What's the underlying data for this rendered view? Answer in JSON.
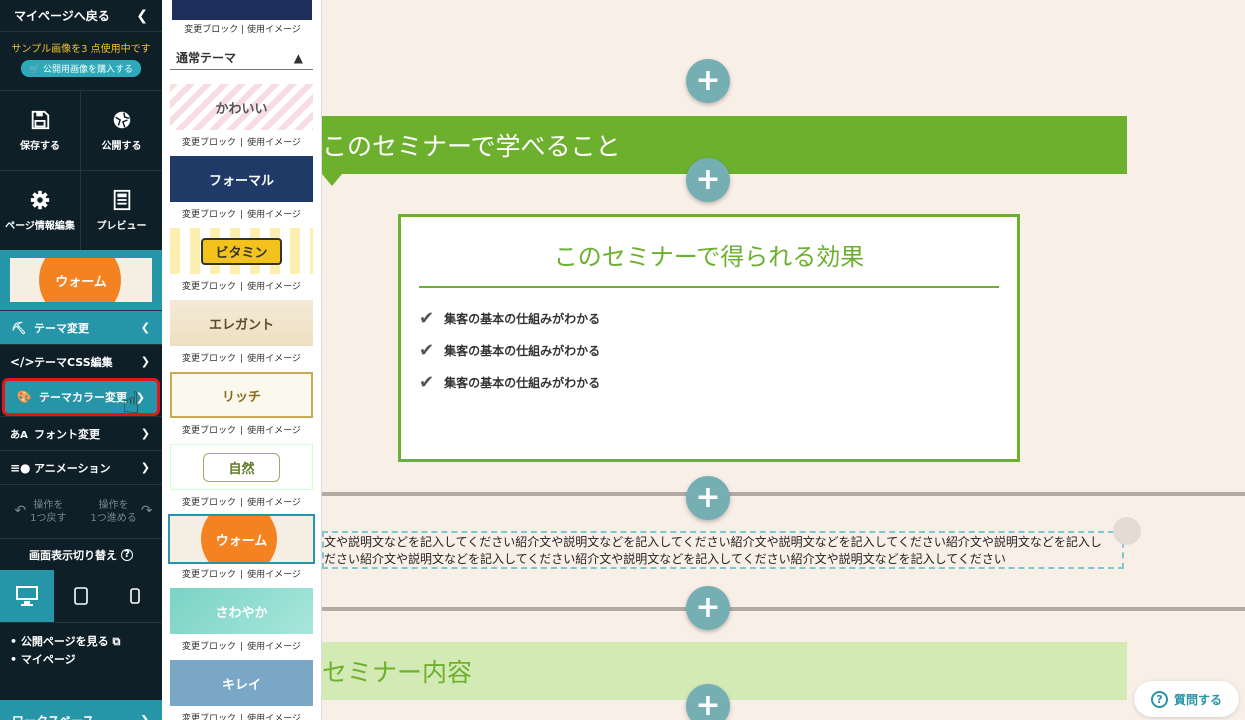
{
  "sidebar": {
    "back_label": "マイページへ戻る",
    "notice_text": "サンプル画像を3 点使用中です",
    "buy_button": "公開用画像を購入する",
    "actions": [
      {
        "label": "保存する",
        "icon": "save-icon"
      },
      {
        "label": "公開する",
        "icon": "publish-icon"
      },
      {
        "label": "ページ情報編集",
        "icon": "gear-icon"
      },
      {
        "label": "プレビュー",
        "icon": "preview-icon"
      }
    ],
    "current_theme_label": "ウォーム",
    "menu": [
      {
        "label": "テーマ変更",
        "icon": "paint-roller-icon",
        "state": "open"
      },
      {
        "label": "テーマCSS編集",
        "icon": "code-icon"
      },
      {
        "label": "テーマカラー変更",
        "icon": "palette-icon",
        "state": "highlighted"
      },
      {
        "label": "フォント変更",
        "icon": "font-icon"
      },
      {
        "label": "アニメーション",
        "icon": "animation-icon"
      }
    ],
    "undo_label_1": "操作を",
    "undo_label_2": "1つ戻す",
    "redo_label_1": "操作を",
    "redo_label_2": "1つ進める",
    "display_switch_label": "画面表示切り替え",
    "links": [
      "公開ページを見る",
      "マイページ"
    ],
    "workspace_label": "ワークスペース"
  },
  "themes_panel": {
    "top_caption": "変更ブロック | 使用イメージ",
    "section_title": "通常テーマ",
    "change_block": "変更ブロック",
    "use_image": "使用イメージ",
    "items": [
      {
        "name": "かわいい",
        "style": "kawaii"
      },
      {
        "name": "フォーマル",
        "style": "formal"
      },
      {
        "name": "ビタミン",
        "style": "vitamin"
      },
      {
        "name": "エレガント",
        "style": "elegant"
      },
      {
        "name": "リッチ",
        "style": "rich"
      },
      {
        "name": "自然",
        "style": "natural"
      },
      {
        "name": "ウォーム",
        "style": "warm",
        "selected": true
      },
      {
        "name": "さわやか",
        "style": "fresh"
      },
      {
        "name": "キレイ",
        "style": "kirei"
      }
    ]
  },
  "main": {
    "band1_title": "このセミナーで学べること",
    "box_title": "このセミナーで得られる効果",
    "box_items": [
      "集客の基本の仕組みがわかる",
      "集客の基本の仕組みがわかる",
      "集客の基本の仕組みがわかる"
    ],
    "text_line1": "文や説明文などを記入してください紹介文や説明文などを記入してください紹介文や説明文などを記入してください紹介文や説明文などを記入し",
    "text_line2": "ださい紹介文や説明文などを記入してください紹介文や説明文などを記入してください紹介文や説明文などを記入してください",
    "band2_title": "セミナー内容",
    "add_symbol": "+",
    "help_label": "質問する"
  },
  "colors": {
    "sidebar_bg": "#0e1f27",
    "accent_teal": "#2795a8",
    "green": "#6db02d",
    "page_bg": "#f8efe7",
    "highlight_red": "#e0171a"
  }
}
